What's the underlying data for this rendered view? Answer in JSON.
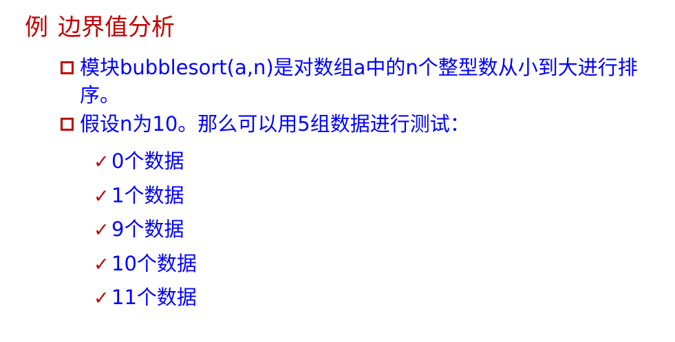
{
  "slide": {
    "title_prefix": "例",
    "title": "边界值分析",
    "bullets": [
      {
        "text": "模块bubblesort(a,n)是对数组a中的n个整型数从小到大进行排序。"
      },
      {
        "text": "假设n为10。那么可以用5组数据进行测试："
      }
    ],
    "sub_items": [
      {
        "text": "0个数据"
      },
      {
        "text": "1个数据"
      },
      {
        "text": "9个数据"
      },
      {
        "text": "10个数据"
      },
      {
        "text": "11个数据"
      }
    ],
    "colors": {
      "title": "#c00000",
      "body": "#0000ff",
      "bullet_marker": "#c00000",
      "check_marker": "#c00000"
    },
    "icons": {
      "bullet": "square-outline-icon",
      "sub_bullet": "checkmark-icon"
    }
  }
}
